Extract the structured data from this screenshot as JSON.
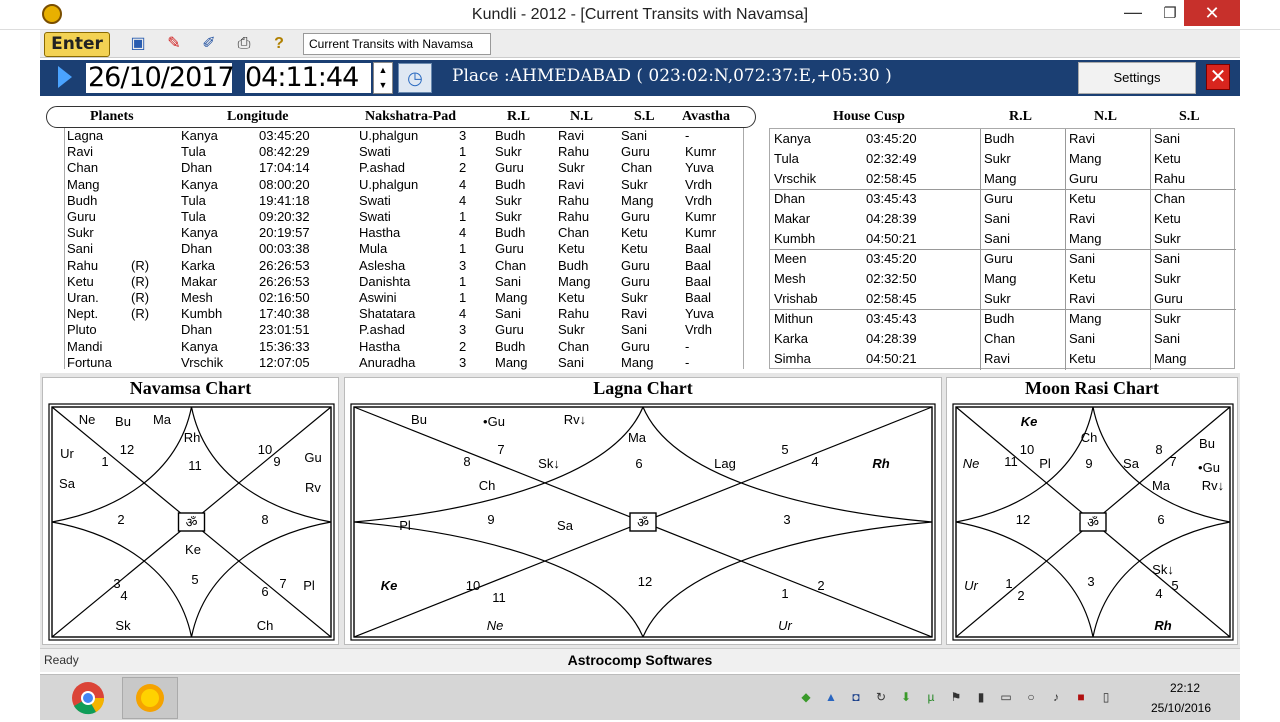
{
  "window": {
    "title": "Kundli - 2012 - [Current Transits with Navamsa]",
    "minimize": "—",
    "maximize": "❐",
    "close": "✕"
  },
  "toolbar": {
    "enter_label": "Enter",
    "view_select": "Current Transits with Navamsa"
  },
  "datebar": {
    "date": "26/10/2017",
    "time": "04:11:44",
    "place": "Place :AHMEDABAD ( 023:02:N,072:37:E,+05:30 )",
    "settings_label": "Settings",
    "spin_up": "▲",
    "spin_down": "▼"
  },
  "planets_table": {
    "headers": [
      "Planets",
      "Longitude",
      "Nakshatra-Pad",
      "R.L",
      "N.L",
      "S.L",
      "Avastha"
    ],
    "rows": [
      {
        "planet": "Lagna",
        "retro": "",
        "sign": "Kanya",
        "deg": "03:45:20",
        "nak": "U.phalgun",
        "pad": "3",
        "rl": "Budh",
        "nl": "Ravi",
        "sl": "Sani",
        "av": "-"
      },
      {
        "planet": "Ravi",
        "retro": "",
        "sign": "Tula",
        "deg": "08:42:29",
        "nak": "Swati",
        "pad": "1",
        "rl": "Sukr",
        "nl": "Rahu",
        "sl": "Guru",
        "av": "Kumr"
      },
      {
        "planet": "Chan",
        "retro": "",
        "sign": "Dhan",
        "deg": "17:04:14",
        "nak": "P.ashad",
        "pad": "2",
        "rl": "Guru",
        "nl": "Sukr",
        "sl": "Chan",
        "av": "Yuva"
      },
      {
        "planet": "Mang",
        "retro": "",
        "sign": "Kanya",
        "deg": "08:00:20",
        "nak": "U.phalgun",
        "pad": "4",
        "rl": "Budh",
        "nl": "Ravi",
        "sl": "Sukr",
        "av": "Vrdh"
      },
      {
        "planet": "Budh",
        "retro": "",
        "sign": "Tula",
        "deg": "19:41:18",
        "nak": "Swati",
        "pad": "4",
        "rl": "Sukr",
        "nl": "Rahu",
        "sl": "Mang",
        "av": "Vrdh"
      },
      {
        "planet": "Guru",
        "retro": "",
        "sign": "Tula",
        "deg": "09:20:32",
        "nak": "Swati",
        "pad": "1",
        "rl": "Sukr",
        "nl": "Rahu",
        "sl": "Guru",
        "av": "Kumr"
      },
      {
        "planet": "Sukr",
        "retro": "",
        "sign": "Kanya",
        "deg": "20:19:57",
        "nak": "Hastha",
        "pad": "4",
        "rl": "Budh",
        "nl": "Chan",
        "sl": "Ketu",
        "av": "Kumr"
      },
      {
        "planet": "Sani",
        "retro": "",
        "sign": "Dhan",
        "deg": "00:03:38",
        "nak": "Mula",
        "pad": "1",
        "rl": "Guru",
        "nl": "Ketu",
        "sl": "Ketu",
        "av": "Baal"
      },
      {
        "planet": "Rahu",
        "retro": "(R)",
        "sign": "Karka",
        "deg": "26:26:53",
        "nak": "Aslesha",
        "pad": "3",
        "rl": "Chan",
        "nl": "Budh",
        "sl": "Guru",
        "av": "Baal"
      },
      {
        "planet": "Ketu",
        "retro": "(R)",
        "sign": "Makar",
        "deg": "26:26:53",
        "nak": "Danishta",
        "pad": "1",
        "rl": "Sani",
        "nl": "Mang",
        "sl": "Guru",
        "av": "Baal"
      },
      {
        "planet": "Uran.",
        "retro": "(R)",
        "sign": "Mesh",
        "deg": "02:16:50",
        "nak": "Aswini",
        "pad": "1",
        "rl": "Mang",
        "nl": "Ketu",
        "sl": "Sukr",
        "av": "Baal"
      },
      {
        "planet": "Nept.",
        "retro": "(R)",
        "sign": "Kumbh",
        "deg": "17:40:38",
        "nak": "Shatatara",
        "pad": "4",
        "rl": "Sani",
        "nl": "Rahu",
        "sl": "Ravi",
        "av": "Yuva"
      },
      {
        "planet": "Pluto",
        "retro": "",
        "sign": "Dhan",
        "deg": "23:01:51",
        "nak": "P.ashad",
        "pad": "3",
        "rl": "Guru",
        "nl": "Sukr",
        "sl": "Sani",
        "av": "Vrdh"
      },
      {
        "planet": "Mandi",
        "retro": "",
        "sign": "Kanya",
        "deg": "15:36:33",
        "nak": "Hastha",
        "pad": "2",
        "rl": "Budh",
        "nl": "Chan",
        "sl": "Guru",
        "av": "-"
      },
      {
        "planet": "Fortuna",
        "retro": "",
        "sign": "Vrschik",
        "deg": "12:07:05",
        "nak": "Anuradha",
        "pad": "3",
        "rl": "Mang",
        "nl": "Sani",
        "sl": "Mang",
        "av": "-"
      }
    ]
  },
  "cusp_table": {
    "headers": [
      "House Cusp",
      "R.L",
      "N.L",
      "S.L"
    ],
    "rows": [
      {
        "sign": "Kanya",
        "deg": "03:45:20",
        "rl": "Budh",
        "nl": "Ravi",
        "sl": "Sani"
      },
      {
        "sign": "Tula",
        "deg": "02:32:49",
        "rl": "Sukr",
        "nl": "Mang",
        "sl": "Ketu"
      },
      {
        "sign": "Vrschik",
        "deg": "02:58:45",
        "rl": "Mang",
        "nl": "Guru",
        "sl": "Rahu"
      },
      {
        "sign": "Dhan",
        "deg": "03:45:43",
        "rl": "Guru",
        "nl": "Ketu",
        "sl": "Chan"
      },
      {
        "sign": "Makar",
        "deg": "04:28:39",
        "rl": "Sani",
        "nl": "Ravi",
        "sl": "Ketu"
      },
      {
        "sign": "Kumbh",
        "deg": "04:50:21",
        "rl": "Sani",
        "nl": "Mang",
        "sl": "Sukr"
      },
      {
        "sign": "Meen",
        "deg": "03:45:20",
        "rl": "Guru",
        "nl": "Sani",
        "sl": "Sani"
      },
      {
        "sign": "Mesh",
        "deg": "02:32:50",
        "rl": "Mang",
        "nl": "Ketu",
        "sl": "Sukr"
      },
      {
        "sign": "Vrishab",
        "deg": "02:58:45",
        "rl": "Sukr",
        "nl": "Ravi",
        "sl": "Guru"
      },
      {
        "sign": "Mithun",
        "deg": "03:45:43",
        "rl": "Budh",
        "nl": "Mang",
        "sl": "Sukr"
      },
      {
        "sign": "Karka",
        "deg": "04:28:39",
        "rl": "Chan",
        "nl": "Sani",
        "sl": "Sani"
      },
      {
        "sign": "Simha",
        "deg": "04:50:21",
        "rl": "Ravi",
        "nl": "Ketu",
        "sl": "Mang"
      }
    ]
  },
  "charts": {
    "navamsa": {
      "title": "Navamsa Chart",
      "center": "ॐ",
      "labels": [
        {
          "t": "Ne"
        },
        {
          "t": "Bu"
        },
        {
          "t": "Ma"
        },
        {
          "t": "Rh"
        },
        {
          "t": "12"
        },
        {
          "t": "11"
        },
        {
          "t": "1"
        },
        {
          "t": "Ur"
        },
        {
          "t": "Sa"
        },
        {
          "t": "10"
        },
        {
          "t": "9"
        },
        {
          "t": "Gu"
        },
        {
          "t": "Rv"
        },
        {
          "t": "2"
        },
        {
          "t": "8"
        },
        {
          "t": "Ke"
        },
        {
          "t": "5"
        },
        {
          "t": "3"
        },
        {
          "t": "4"
        },
        {
          "t": "6"
        },
        {
          "t": "7"
        },
        {
          "t": "Pl"
        },
        {
          "t": "Sk"
        },
        {
          "t": "Ch"
        }
      ]
    },
    "lagna": {
      "title": "Lagna Chart",
      "center": "ॐ",
      "labels": [
        {
          "t": "Bu"
        },
        {
          "t": "•Gu"
        },
        {
          "t": "Rv↓"
        },
        {
          "t": "Ma"
        },
        {
          "t": "7"
        },
        {
          "t": "8"
        },
        {
          "t": "Sk↓"
        },
        {
          "t": "6"
        },
        {
          "t": "Lag"
        },
        {
          "t": "5"
        },
        {
          "t": "4"
        },
        {
          "t": "Rh",
          "bi": true
        },
        {
          "t": "Ch"
        },
        {
          "t": "9"
        },
        {
          "t": "Sa"
        },
        {
          "t": "3"
        },
        {
          "t": "Pl"
        },
        {
          "t": "Ke",
          "bi": true
        },
        {
          "t": "10"
        },
        {
          "t": "11"
        },
        {
          "t": "12"
        },
        {
          "t": "1"
        },
        {
          "t": "2"
        },
        {
          "t": "Ne",
          "i": true
        },
        {
          "t": "Ur",
          "i": true
        }
      ]
    },
    "moon": {
      "title": "Moon Rasi Chart",
      "center": "ॐ",
      "labels": [
        {
          "t": "Ke",
          "bi": true
        },
        {
          "t": "Ch"
        },
        {
          "t": "Ne",
          "i": true
        },
        {
          "t": "10"
        },
        {
          "t": "11"
        },
        {
          "t": "Pl"
        },
        {
          "t": "9"
        },
        {
          "t": "Sa"
        },
        {
          "t": "8"
        },
        {
          "t": "7"
        },
        {
          "t": "Bu"
        },
        {
          "t": "•Gu"
        },
        {
          "t": "Rv↓"
        },
        {
          "t": "Ma"
        },
        {
          "t": "12"
        },
        {
          "t": "6"
        },
        {
          "t": "3"
        },
        {
          "t": "Sk↓"
        },
        {
          "t": "5"
        },
        {
          "t": "1"
        },
        {
          "t": "2"
        },
        {
          "t": "4"
        },
        {
          "t": "Ur",
          "i": true
        },
        {
          "t": "Rh",
          "bi": true
        }
      ]
    }
  },
  "statusbar": {
    "left": "Ready",
    "center": "Astrocomp Softwares"
  },
  "taskbar": {
    "time": "22:12",
    "date": "25/10/2016"
  }
}
